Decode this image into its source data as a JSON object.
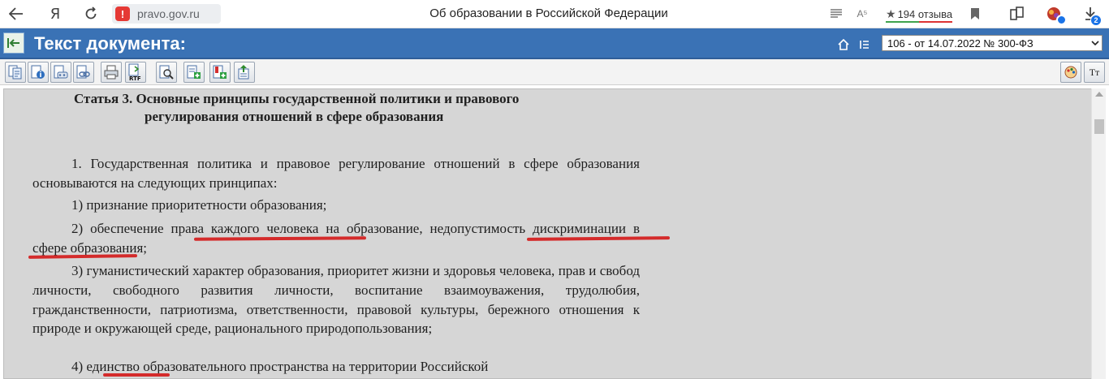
{
  "browser": {
    "ya_label": "Я",
    "warn_symbol": "!",
    "url": "pravo.gov.ru",
    "tab_title": "Об образовании в Российской Федерации",
    "reviews_label": "194 отзыва",
    "downloads_count": "2",
    "translate_label": "A⁵",
    "icons": [
      "back-arrow-icon",
      "yandex-icon",
      "reload-icon",
      "warning-icon",
      "reader-mode-icon",
      "translate-icon",
      "star-icon",
      "bookmark-icon",
      "collections-icon",
      "extension-icon",
      "download-icon"
    ]
  },
  "header": {
    "title": "Текст документа:",
    "edition_select": "106 - от 14.07.2022 № 300-ФЗ"
  },
  "toolbar": {
    "buttons": [
      "copy-doc",
      "info",
      "print-copy",
      "link",
      "print",
      "rtf-export",
      "find",
      "add-green",
      "add-red",
      "tree"
    ],
    "rtf_label": "RTF",
    "font_size_label": "Tт"
  },
  "document": {
    "article_title_line1": "Статья 3. Основные принципы государственной политики и правового",
    "article_title_line2": "регулирования отношений в сфере образования",
    "p1": "1. Государственная политика и правовое регулирование отношений в сфере образования основываются на следующих принципах:",
    "p2": "1) признание приоритетности образования;",
    "p3": "2) обеспечение права каждого человека на образование, недопустимость дискриминации в сфере образования;",
    "p4": "3) гуманистический характер образования, приоритет жизни и здоровья человека, прав и свобод личности, свободного развития личности, воспитание взаимоуважения, трудолюбия, гражданственности, патриотизма, ответственности, правовой культуры, бережного отношения к природе и окружающей среде, рационального природопользования;",
    "p5": "4) единство образовательного пространства на территории Российской"
  },
  "colors": {
    "header_blue": "#3a72b5",
    "doc_bg": "#d6d6d6",
    "underline_red": "#d42b2b"
  }
}
